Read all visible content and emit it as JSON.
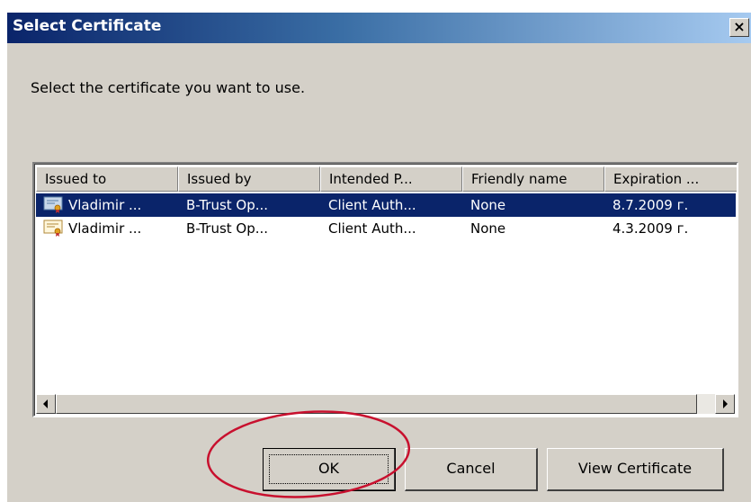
{
  "dialog": {
    "title": "Select Certificate",
    "close_glyph": "×",
    "instruction": "Select the certificate you want to use."
  },
  "columns": [
    "Issued to",
    "Issued by",
    "Intended P...",
    "Friendly name",
    "Expiration ..."
  ],
  "rows": [
    {
      "issued_to": "Vladimir ...",
      "issued_by": "B-Trust Op...",
      "intended": "Client Auth...",
      "friendly": "None",
      "expiration": "8.7.2009 г.",
      "selected": true,
      "icon": "certificate-icon"
    },
    {
      "issued_to": "Vladimir ...",
      "issued_by": "B-Trust Op...",
      "intended": "Client Auth...",
      "friendly": "None",
      "expiration": "4.3.2009 г.",
      "selected": false,
      "icon": "certificate-icon"
    }
  ],
  "buttons": {
    "ok": "OK",
    "cancel": "Cancel",
    "view": "View Certificate"
  },
  "colors": {
    "dialog_bg": "#d4d0c8",
    "selection": "#0a246a",
    "annotation": "#c8102e"
  }
}
